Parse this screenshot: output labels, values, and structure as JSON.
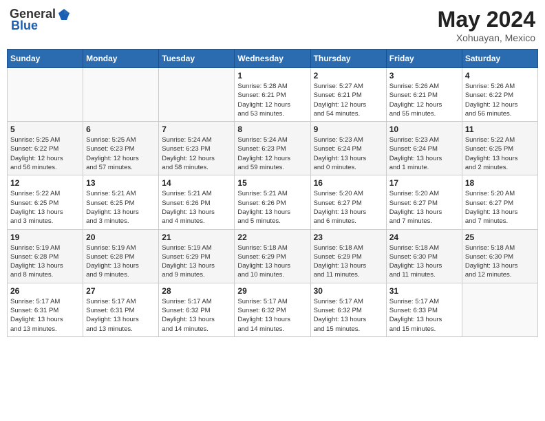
{
  "header": {
    "logo_general": "General",
    "logo_blue": "Blue",
    "month_title": "May 2024",
    "location": "Xohuayan, Mexico"
  },
  "weekdays": [
    "Sunday",
    "Monday",
    "Tuesday",
    "Wednesday",
    "Thursday",
    "Friday",
    "Saturday"
  ],
  "weeks": [
    [
      {
        "day": "",
        "info": ""
      },
      {
        "day": "",
        "info": ""
      },
      {
        "day": "",
        "info": ""
      },
      {
        "day": "1",
        "info": "Sunrise: 5:28 AM\nSunset: 6:21 PM\nDaylight: 12 hours\nand 53 minutes."
      },
      {
        "day": "2",
        "info": "Sunrise: 5:27 AM\nSunset: 6:21 PM\nDaylight: 12 hours\nand 54 minutes."
      },
      {
        "day": "3",
        "info": "Sunrise: 5:26 AM\nSunset: 6:21 PM\nDaylight: 12 hours\nand 55 minutes."
      },
      {
        "day": "4",
        "info": "Sunrise: 5:26 AM\nSunset: 6:22 PM\nDaylight: 12 hours\nand 56 minutes."
      }
    ],
    [
      {
        "day": "5",
        "info": "Sunrise: 5:25 AM\nSunset: 6:22 PM\nDaylight: 12 hours\nand 56 minutes."
      },
      {
        "day": "6",
        "info": "Sunrise: 5:25 AM\nSunset: 6:23 PM\nDaylight: 12 hours\nand 57 minutes."
      },
      {
        "day": "7",
        "info": "Sunrise: 5:24 AM\nSunset: 6:23 PM\nDaylight: 12 hours\nand 58 minutes."
      },
      {
        "day": "8",
        "info": "Sunrise: 5:24 AM\nSunset: 6:23 PM\nDaylight: 12 hours\nand 59 minutes."
      },
      {
        "day": "9",
        "info": "Sunrise: 5:23 AM\nSunset: 6:24 PM\nDaylight: 13 hours\nand 0 minutes."
      },
      {
        "day": "10",
        "info": "Sunrise: 5:23 AM\nSunset: 6:24 PM\nDaylight: 13 hours\nand 1 minute."
      },
      {
        "day": "11",
        "info": "Sunrise: 5:22 AM\nSunset: 6:25 PM\nDaylight: 13 hours\nand 2 minutes."
      }
    ],
    [
      {
        "day": "12",
        "info": "Sunrise: 5:22 AM\nSunset: 6:25 PM\nDaylight: 13 hours\nand 3 minutes."
      },
      {
        "day": "13",
        "info": "Sunrise: 5:21 AM\nSunset: 6:25 PM\nDaylight: 13 hours\nand 3 minutes."
      },
      {
        "day": "14",
        "info": "Sunrise: 5:21 AM\nSunset: 6:26 PM\nDaylight: 13 hours\nand 4 minutes."
      },
      {
        "day": "15",
        "info": "Sunrise: 5:21 AM\nSunset: 6:26 PM\nDaylight: 13 hours\nand 5 minutes."
      },
      {
        "day": "16",
        "info": "Sunrise: 5:20 AM\nSunset: 6:27 PM\nDaylight: 13 hours\nand 6 minutes."
      },
      {
        "day": "17",
        "info": "Sunrise: 5:20 AM\nSunset: 6:27 PM\nDaylight: 13 hours\nand 7 minutes."
      },
      {
        "day": "18",
        "info": "Sunrise: 5:20 AM\nSunset: 6:27 PM\nDaylight: 13 hours\nand 7 minutes."
      }
    ],
    [
      {
        "day": "19",
        "info": "Sunrise: 5:19 AM\nSunset: 6:28 PM\nDaylight: 13 hours\nand 8 minutes."
      },
      {
        "day": "20",
        "info": "Sunrise: 5:19 AM\nSunset: 6:28 PM\nDaylight: 13 hours\nand 9 minutes."
      },
      {
        "day": "21",
        "info": "Sunrise: 5:19 AM\nSunset: 6:29 PM\nDaylight: 13 hours\nand 9 minutes."
      },
      {
        "day": "22",
        "info": "Sunrise: 5:18 AM\nSunset: 6:29 PM\nDaylight: 13 hours\nand 10 minutes."
      },
      {
        "day": "23",
        "info": "Sunrise: 5:18 AM\nSunset: 6:29 PM\nDaylight: 13 hours\nand 11 minutes."
      },
      {
        "day": "24",
        "info": "Sunrise: 5:18 AM\nSunset: 6:30 PM\nDaylight: 13 hours\nand 11 minutes."
      },
      {
        "day": "25",
        "info": "Sunrise: 5:18 AM\nSunset: 6:30 PM\nDaylight: 13 hours\nand 12 minutes."
      }
    ],
    [
      {
        "day": "26",
        "info": "Sunrise: 5:17 AM\nSunset: 6:31 PM\nDaylight: 13 hours\nand 13 minutes."
      },
      {
        "day": "27",
        "info": "Sunrise: 5:17 AM\nSunset: 6:31 PM\nDaylight: 13 hours\nand 13 minutes."
      },
      {
        "day": "28",
        "info": "Sunrise: 5:17 AM\nSunset: 6:32 PM\nDaylight: 13 hours\nand 14 minutes."
      },
      {
        "day": "29",
        "info": "Sunrise: 5:17 AM\nSunset: 6:32 PM\nDaylight: 13 hours\nand 14 minutes."
      },
      {
        "day": "30",
        "info": "Sunrise: 5:17 AM\nSunset: 6:32 PM\nDaylight: 13 hours\nand 15 minutes."
      },
      {
        "day": "31",
        "info": "Sunrise: 5:17 AM\nSunset: 6:33 PM\nDaylight: 13 hours\nand 15 minutes."
      },
      {
        "day": "",
        "info": ""
      }
    ]
  ]
}
